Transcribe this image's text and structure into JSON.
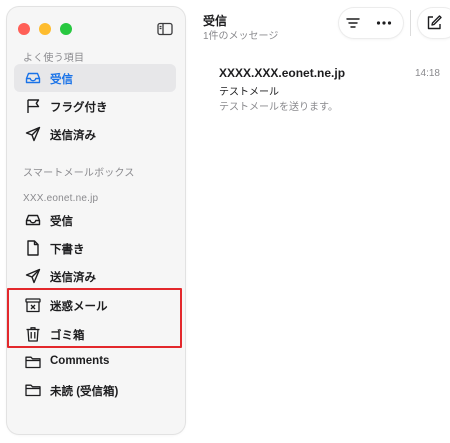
{
  "sidebar": {
    "favorites_header": "よく使う項目",
    "favorites": [
      {
        "label": "受信",
        "icon": "inbox-icon",
        "selected": true
      },
      {
        "label": "フラグ付き",
        "icon": "flag-icon",
        "selected": false
      },
      {
        "label": "送信済み",
        "icon": "sent-icon",
        "selected": false
      }
    ],
    "smart_header": "スマートメールボックス",
    "account_header": "XXX.eonet.ne.jp",
    "account_items": [
      {
        "label": "受信",
        "icon": "inbox-icon"
      },
      {
        "label": "下書き",
        "icon": "draft-icon"
      },
      {
        "label": "送信済み",
        "icon": "sent-icon"
      },
      {
        "label": "迷惑メール",
        "icon": "junk-icon"
      },
      {
        "label": "ゴミ箱",
        "icon": "trash-icon"
      },
      {
        "label": "Comments",
        "icon": "folder-icon"
      },
      {
        "label": "未読 (受信箱)",
        "icon": "folder-icon"
      }
    ]
  },
  "header": {
    "title": "受信",
    "subtitle": "1件のメッセージ"
  },
  "messages": [
    {
      "sender": "XXXX.XXX.eonet.ne.jp",
      "time": "14:18",
      "subject": "テストメール",
      "preview": "テストメールを送ります。"
    }
  ],
  "colors": {
    "accent": "#1a73e8",
    "highlight_border": "#e3282c",
    "selected_bg": "#e7e7e9"
  }
}
